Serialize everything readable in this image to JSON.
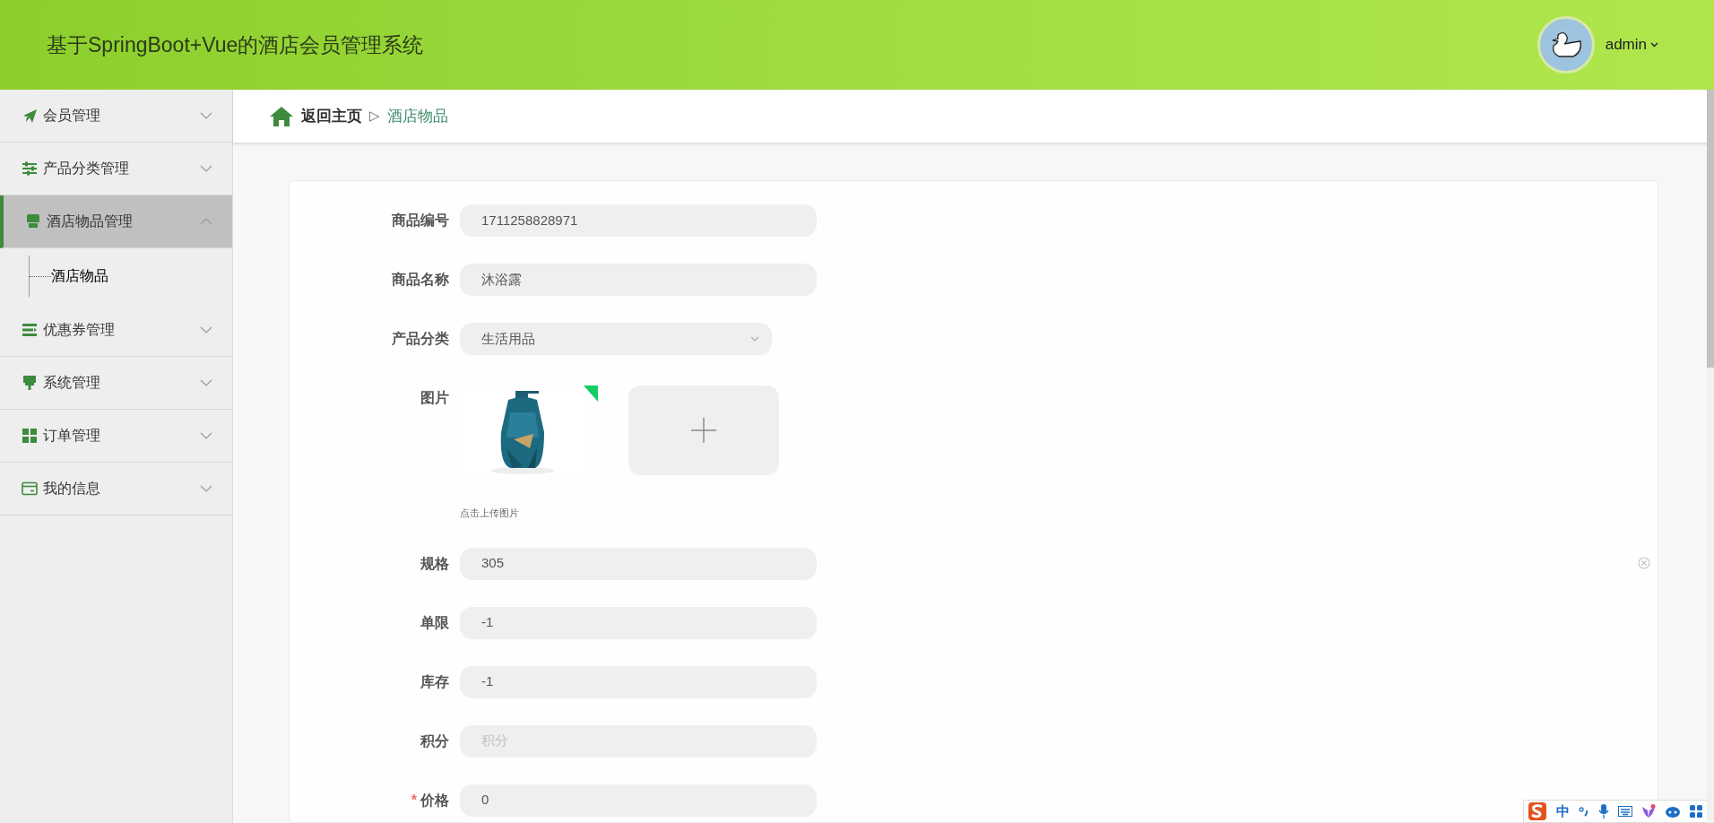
{
  "header": {
    "title": "基于SpringBoot+Vue的酒店会员管理系统",
    "user": "admin"
  },
  "sidebar": {
    "items": [
      {
        "label": "会员管理",
        "expanded": false,
        "selected": false
      },
      {
        "label": "产品分类管理",
        "expanded": false,
        "selected": false
      },
      {
        "label": "酒店物品管理",
        "expanded": true,
        "selected": true,
        "children": [
          {
            "label": "酒店物品",
            "selected": true
          }
        ]
      },
      {
        "label": "优惠券管理",
        "expanded": false,
        "selected": false
      },
      {
        "label": "系统管理",
        "expanded": false,
        "selected": false
      },
      {
        "label": "订单管理",
        "expanded": false,
        "selected": false
      },
      {
        "label": "我的信息",
        "expanded": false,
        "selected": false
      }
    ]
  },
  "breadcrumb": {
    "home": "返回主页",
    "separator": "▷",
    "current": "酒店物品"
  },
  "form": {
    "fields": [
      {
        "kind": "text",
        "label": "商品编号",
        "value": "1711258828971"
      },
      {
        "kind": "text",
        "label": "商品名称",
        "value": "沐浴露"
      },
      {
        "kind": "select",
        "label": "产品分类",
        "value": "生活用品"
      },
      {
        "label": "图片",
        "hint": "点击上传图片"
      },
      {
        "kind": "text",
        "label": "规格",
        "value": "305",
        "clearable": true
      },
      {
        "kind": "text",
        "label": "单限",
        "value": "-1"
      },
      {
        "kind": "text",
        "label": "库存",
        "value": "-1"
      },
      {
        "kind": "text",
        "label": "积分",
        "placeholder": "积分"
      },
      {
        "kind": "text",
        "label": "价格",
        "value": "0",
        "required_mark": "*"
      }
    ]
  },
  "ime": {
    "mode": "中"
  }
}
